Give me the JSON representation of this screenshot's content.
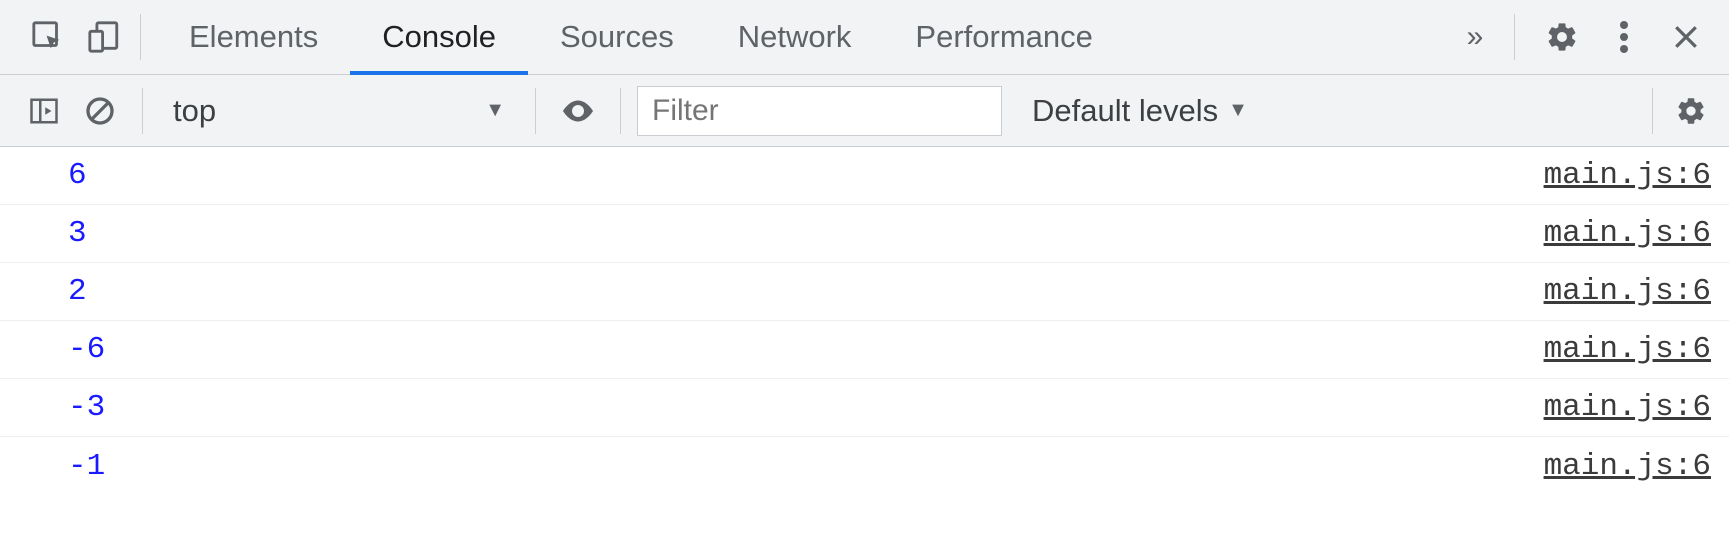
{
  "topbar": {
    "tabs": [
      {
        "label": "Elements",
        "active": false
      },
      {
        "label": "Console",
        "active": true
      },
      {
        "label": "Sources",
        "active": false
      },
      {
        "label": "Network",
        "active": false
      },
      {
        "label": "Performance",
        "active": false
      }
    ]
  },
  "subbar": {
    "context": "top",
    "filter_placeholder": "Filter",
    "levels_label": "Default levels"
  },
  "logs": [
    {
      "value": "6",
      "source": "main.js:6"
    },
    {
      "value": "3",
      "source": "main.js:6"
    },
    {
      "value": "2",
      "source": "main.js:6"
    },
    {
      "value": "-6",
      "source": "main.js:6"
    },
    {
      "value": "-3",
      "source": "main.js:6"
    },
    {
      "value": "-1",
      "source": "main.js:6"
    }
  ]
}
